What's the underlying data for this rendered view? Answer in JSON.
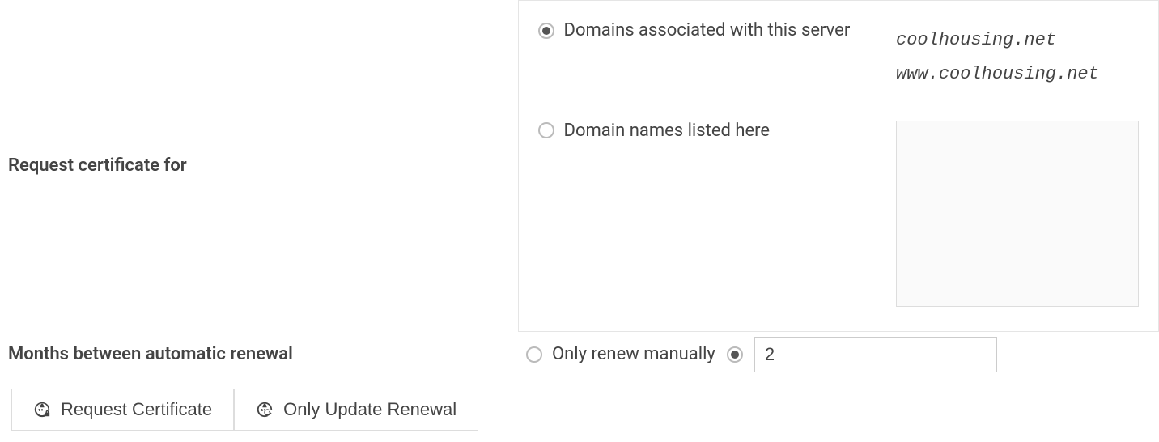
{
  "form": {
    "request_for": {
      "label": "Request certificate for",
      "option_assoc": "Domains associated with this server",
      "option_listed": "Domain names listed here",
      "selected": "assoc",
      "associated_domains": [
        "coolhousing.net",
        "www.coolhousing.net"
      ],
      "listed_value": ""
    },
    "renewal": {
      "label": "Months between automatic renewal",
      "option_manual": "Only renew manually",
      "selected": "months",
      "months_value": "2"
    }
  },
  "buttons": {
    "request": "Request Certificate",
    "update": "Only Update Renewal"
  },
  "icons": {
    "globe_lock": "globe-lock-icon",
    "globe_refresh": "globe-refresh-icon"
  }
}
